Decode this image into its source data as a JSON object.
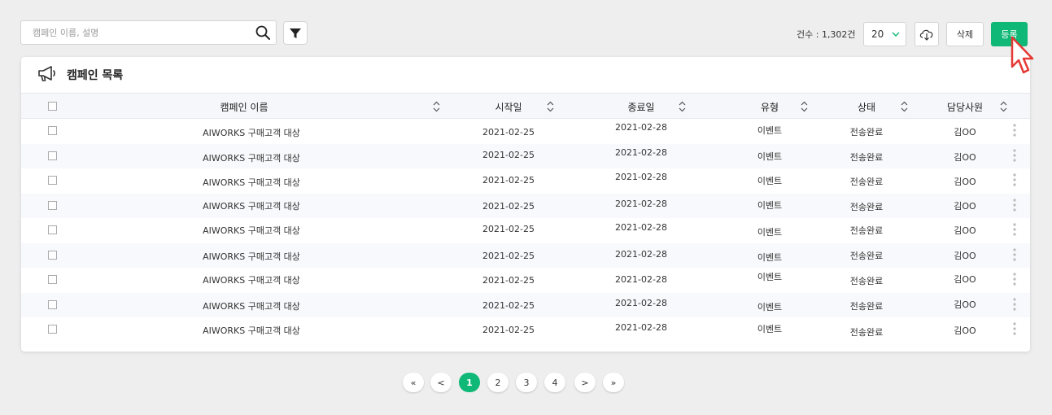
{
  "toolbar": {
    "search_placeholder": "캠페인 이름, 설명",
    "count_label": "건수 : 1,302건",
    "page_size": "20",
    "delete_label": "삭제",
    "register_label": "등록"
  },
  "card": {
    "title": "캠페인 목록"
  },
  "table": {
    "columns": [
      "캠페인 이름",
      "시작일",
      "종료일",
      "유형",
      "상태",
      "담당사원"
    ],
    "rows": [
      [
        "AIWORKS 구매고객 대상",
        "2021-02-25",
        "2021-02-28",
        "이벤트",
        "전송완료",
        "김OO"
      ],
      [
        "AIWORKS 구매고객 대상",
        "2021-02-25",
        "2021-02-28",
        "이벤트",
        "전송완료",
        "김OO"
      ],
      [
        "AIWORKS 구매고객 대상",
        "2021-02-25",
        "2021-02-28",
        "이벤트",
        "전송완료",
        "김OO"
      ],
      [
        "AIWORKS 구매고객 대상",
        "2021-02-25",
        "2021-02-28",
        "이벤트",
        "전송완료",
        "김OO"
      ],
      [
        "AIWORKS 구매고객 대상",
        "2021-02-25",
        "2021-02-28",
        "이벤트",
        "전송완료",
        "김OO"
      ],
      [
        "AIWORKS 구매고객 대상",
        "2021-02-25",
        "2021-02-28",
        "이벤트",
        "전송완료",
        "김OO"
      ],
      [
        "AIWORKS 구매고객 대상",
        "2021-02-25",
        "2021-02-28",
        "이벤트",
        "전송완료",
        "김OO"
      ],
      [
        "AIWORKS 구매고객 대상",
        "2021-02-25",
        "2021-02-28",
        "이벤트",
        "전송완료",
        "김OO"
      ],
      [
        "AIWORKS 구매고객 대상",
        "2021-02-25",
        "2021-02-28",
        "이벤트",
        "전송완료",
        "김OO"
      ]
    ]
  },
  "pagination": {
    "first": "«",
    "prev": "<",
    "pages": [
      "1",
      "2",
      "3",
      "4"
    ],
    "current": "1",
    "next": ">",
    "last": "»"
  },
  "icons": {
    "search": "search-icon",
    "filter": "funnel-icon",
    "download": "cloud-download-icon",
    "header": "megaphone-icon",
    "sort": "sort-icon",
    "more": "more-vertical-icon",
    "cursor": "pointer-cursor-icon"
  },
  "colors": {
    "accent": "#10b877",
    "background": "#eeeeee",
    "header_row": "#f6f7fb",
    "alt_row": "#f8f9fc"
  }
}
